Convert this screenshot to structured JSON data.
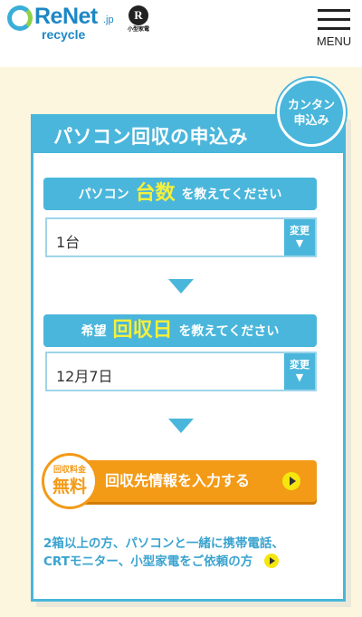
{
  "header": {
    "logo_text": "ReNet",
    "logo_suffix": ".jp",
    "logo_sub": "recycle",
    "badge_letter": "R",
    "badge_caption": "小型家電",
    "menu_label": "MENU"
  },
  "card": {
    "title": "パソコン回収の申込み",
    "easy_badge_line1": "カンタン",
    "easy_badge_line2": "申込み"
  },
  "quantity": {
    "prefix": "パソコン",
    "highlight": "台数",
    "suffix": "を教えてください",
    "value": "1台",
    "change_line1": "変更",
    "change_line2": "▼"
  },
  "date": {
    "prefix": "希望",
    "highlight": "回収日",
    "suffix": "を教えてください",
    "value": "12月7日",
    "change_line1": "変更",
    "change_line2": "▼"
  },
  "cta": {
    "label": "回収先情報を入力する",
    "free_small": "回収料金",
    "free_big": "無料"
  },
  "footer": {
    "line1": "2箱以上の方、パソコンと一緒に携帯電話、",
    "line2": "CRTモニター、小型家電をご依頼の方"
  },
  "colors": {
    "accent": "#4ab6db",
    "orange": "#f39a16",
    "highlight": "#f5f03a",
    "background": "#fdf6df"
  }
}
